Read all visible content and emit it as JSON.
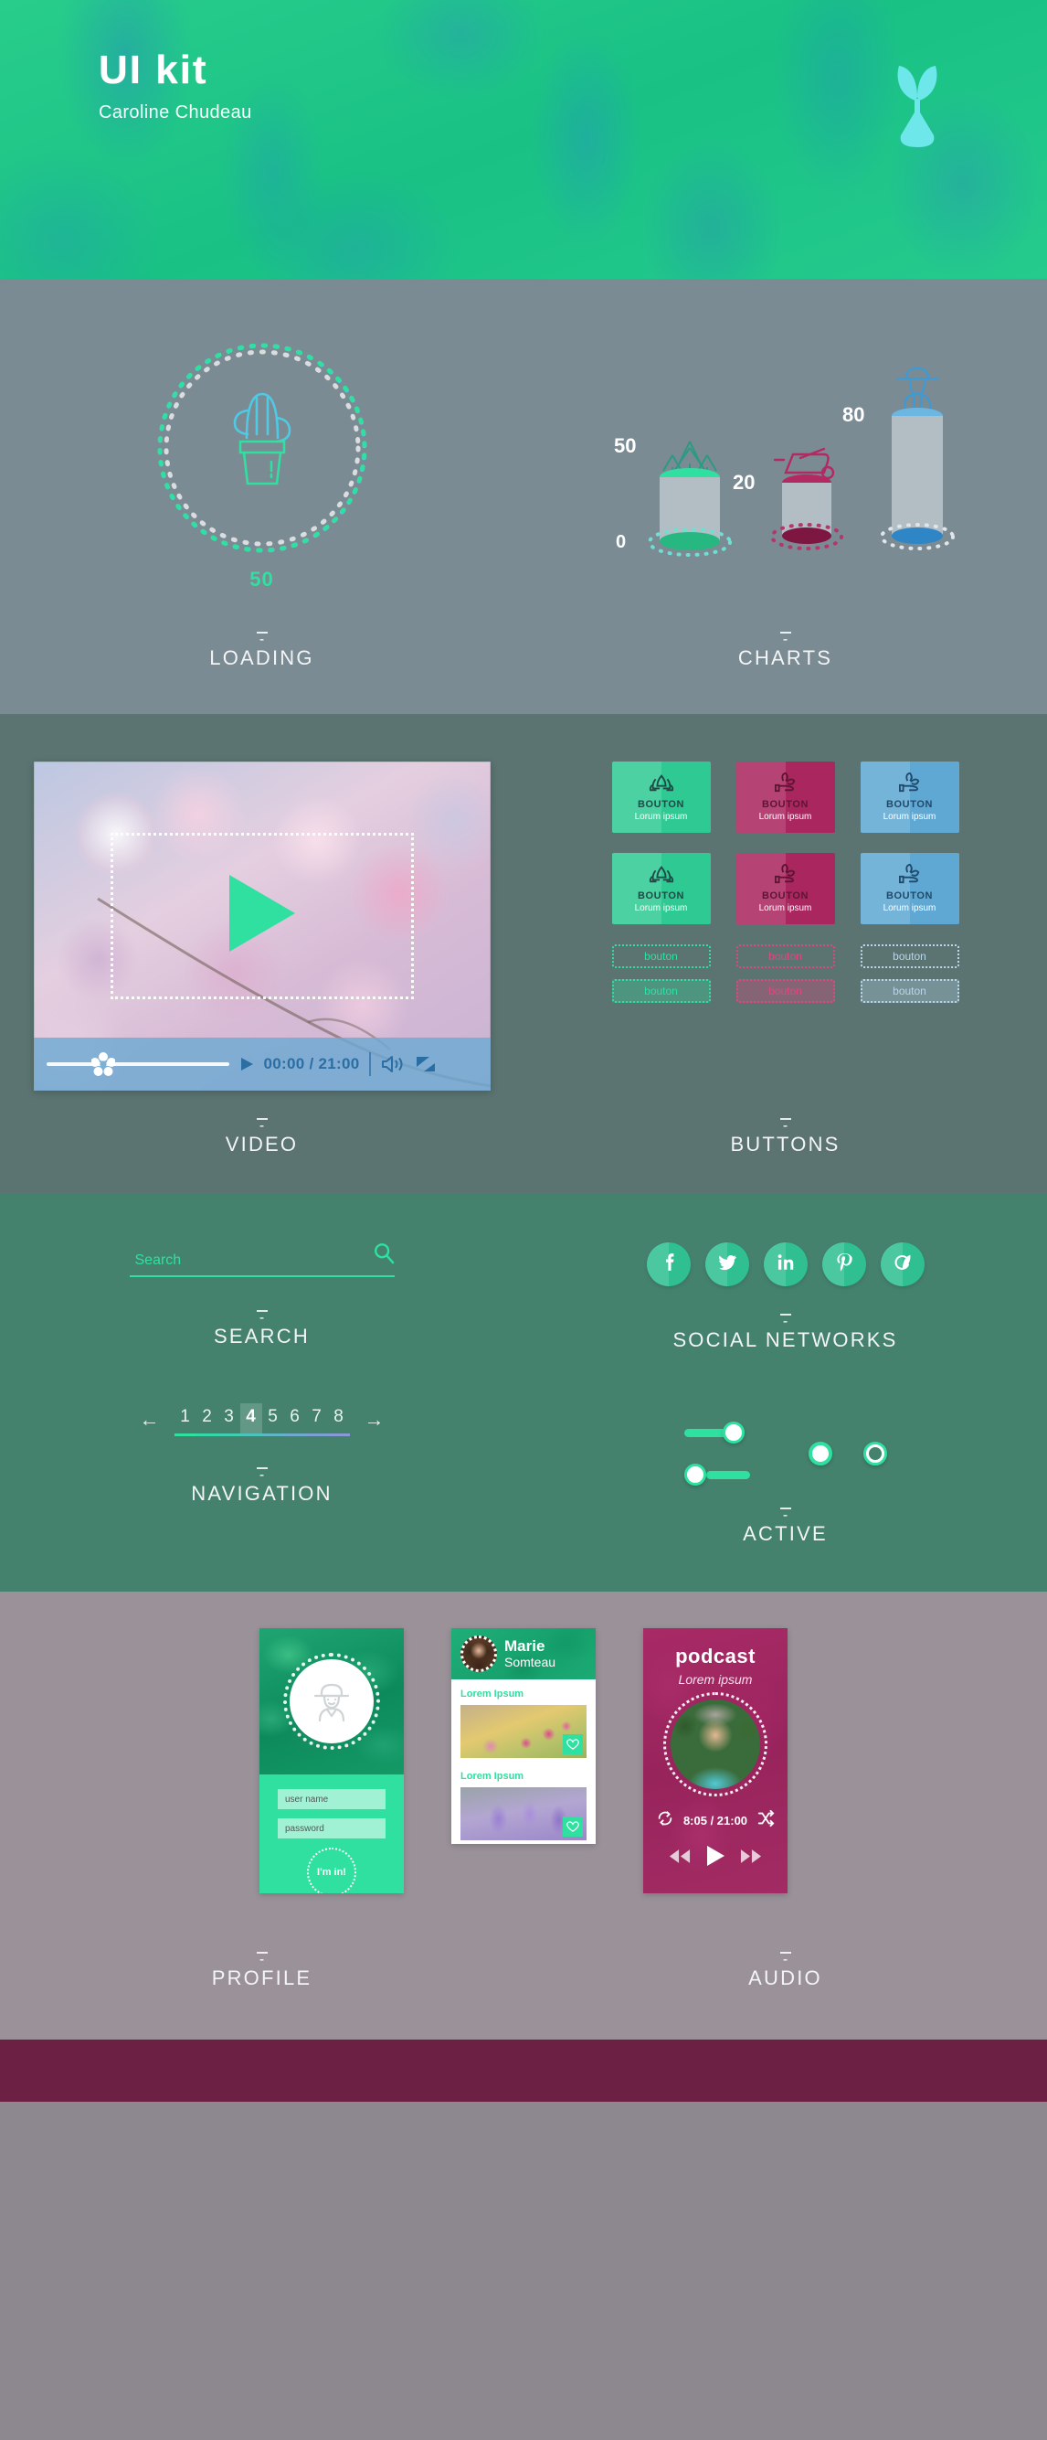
{
  "header": {
    "title": "UI kit",
    "author": "Caroline Chudeau",
    "logo_icon": "sprout-logo-icon"
  },
  "loading": {
    "value": "50",
    "icon": "cactus-icon",
    "label": "LOADING",
    "dash": "-",
    "ring_progress_pct": 50,
    "colors": {
      "progress": "#2fe0a0",
      "track": "#d8dde0",
      "accent2": "#55c8e8"
    }
  },
  "charts": {
    "label": "CHARTS",
    "dash": "-",
    "axis_zero": "0"
  },
  "chart_data": {
    "type": "bar",
    "title": "CHARTS",
    "categories": [
      "Forest",
      "Wheelbarrow",
      "Gardener"
    ],
    "values": [
      50,
      20,
      80
    ],
    "value_labels": [
      "50",
      "20",
      "80"
    ],
    "icons": [
      "forest-trees-icon",
      "wheelbarrow-icon",
      "gardener-person-icon"
    ],
    "colors": [
      "#2fe0a0",
      "#b32a63",
      "#3e9ad4"
    ],
    "ylim": [
      0,
      100
    ],
    "xlabel": "",
    "ylabel": "",
    "grid": false,
    "legend": "none",
    "axis_ticks": [
      "0",
      "50",
      "80",
      "20"
    ]
  },
  "video": {
    "label": "VIDEO",
    "dash": "-",
    "time": "00:00 / 21:00",
    "play_icon": "play-icon",
    "big_play_icon": "play-triangle-icon",
    "volume_icon": "volume-icon",
    "fullscreen_icon": "fullscreen-icon",
    "slider_knob_icon": "flower-knob-icon",
    "progress_pct": 30
  },
  "buttons": {
    "label": "BUTTONS",
    "dash": "-",
    "big": [
      {
        "text": "BOUTON",
        "sub": "Lorum ipsum",
        "icon": "lotus-flower-icon",
        "color": "#2fca93",
        "variant": "green"
      },
      {
        "text": "BOUTON",
        "sub": "Lorum ipsum",
        "icon": "hand-leaf-icon",
        "color": "#a9265f",
        "variant": "pink"
      },
      {
        "text": "BOUTON",
        "sub": "Lorum ipsum",
        "icon": "hand-leaf-icon",
        "color": "#5fa8d3",
        "variant": "blue"
      },
      {
        "text": "BOUTON",
        "sub": "Lorum ipsum",
        "icon": "lotus-flower-icon",
        "color": "#2fca93",
        "variant": "green"
      },
      {
        "text": "BOUTON",
        "sub": "Lorum ipsum",
        "icon": "hand-leaf-icon",
        "color": "#a9265f",
        "variant": "pink"
      },
      {
        "text": "BOUTON",
        "sub": "Lorum ipsum",
        "icon": "hand-leaf-icon",
        "color": "#5fa8d3",
        "variant": "blue"
      }
    ],
    "small": [
      {
        "text": "bouton",
        "variant": "green-outline"
      },
      {
        "text": "bouton",
        "variant": "pink-outline"
      },
      {
        "text": "bouton",
        "variant": "blue-outline"
      },
      {
        "text": "bouton",
        "variant": "green-filled"
      },
      {
        "text": "bouton",
        "variant": "pink-filled"
      },
      {
        "text": "bouton",
        "variant": "blue-filled"
      }
    ]
  },
  "search": {
    "label": "SEARCH",
    "dash": "-",
    "value": "Search",
    "placeholder": "Search",
    "icon": "search-magnifier-icon"
  },
  "social": {
    "label": "SOCIAL NETWORKS",
    "dash": "-",
    "items": [
      {
        "name": "facebook-icon",
        "glyph": "f"
      },
      {
        "name": "twitter-icon",
        "glyph": "t"
      },
      {
        "name": "linkedin-icon",
        "glyph": "in"
      },
      {
        "name": "pinterest-icon",
        "glyph": "P"
      },
      {
        "name": "sprout-logo-icon",
        "glyph": "c"
      }
    ]
  },
  "navigation": {
    "label": "NAVIGATION",
    "dash": "-",
    "prev": "←",
    "next": "→",
    "pages": [
      "1",
      "2",
      "3",
      "4",
      "5",
      "6",
      "7",
      "8"
    ],
    "active_page": "4"
  },
  "active": {
    "label": "ACTIVE",
    "dash": "-",
    "toggle_on_state": "on",
    "toggle_off_state": "off",
    "radio_filled_state": "selected",
    "radio_ring_state": "unselected",
    "accent": "#2fe0a0"
  },
  "profile": {
    "label": "PROFILE",
    "dash": "-",
    "login": {
      "avatar_icon": "gardener-avatar-icon",
      "username_placeholder": "user name",
      "password_placeholder": "password",
      "submit_label": "I'm in!"
    },
    "card": {
      "first_name": "Marie",
      "last_name": "Somteau",
      "avatar_icon": "profile-photo-icon",
      "posts": [
        {
          "title": "Lorem Ipsum",
          "image": "pink-flowers-photo",
          "like_icon": "heart-icon"
        },
        {
          "title": "Lorem Ipsum",
          "image": "lavender-photo",
          "like_icon": "heart-icon"
        }
      ]
    }
  },
  "audio": {
    "label": "AUDIO",
    "dash": "-",
    "title": "podcast",
    "subtitle": "Lorem ipsum",
    "time": "8:05 / 21:00",
    "photo_icon": "host-photo-icon",
    "repeat_icon": "repeat-icon",
    "shuffle_icon": "shuffle-icon",
    "prev_icon": "previous-icon",
    "play_icon": "play-icon",
    "next_icon": "next-icon"
  }
}
